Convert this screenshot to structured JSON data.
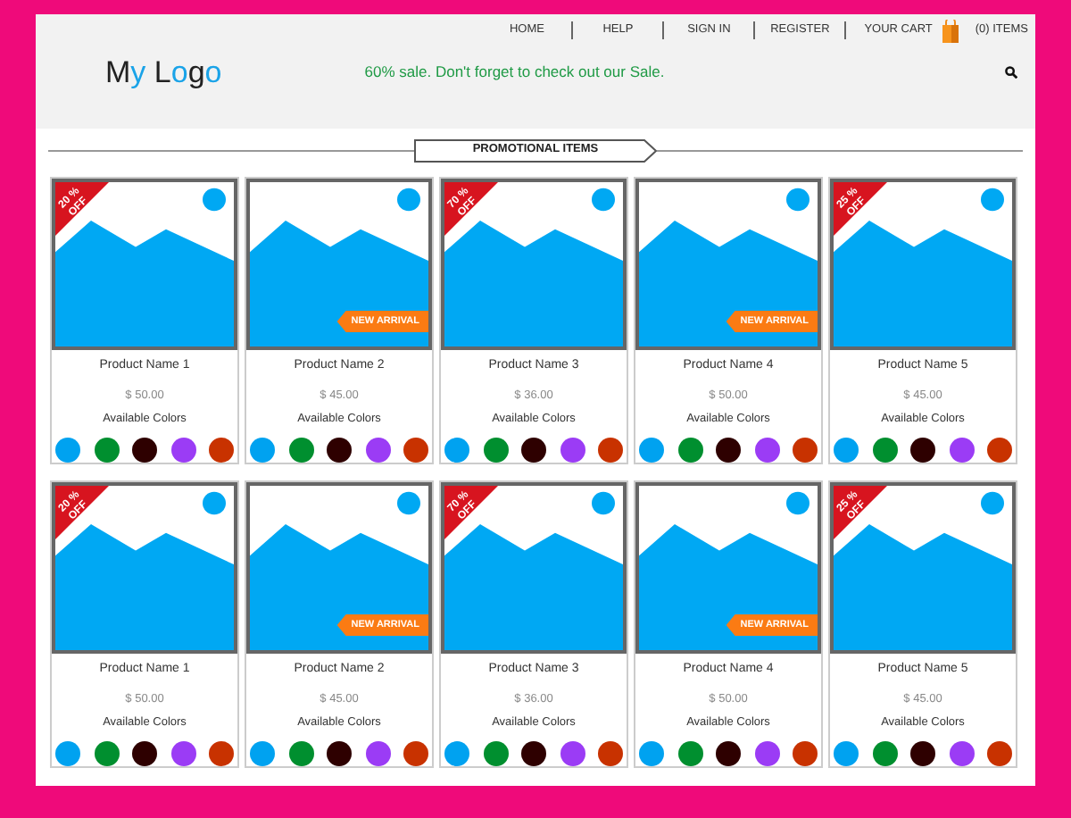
{
  "nav": {
    "links": [
      "HOME",
      "HELP",
      "SIGN IN",
      "REGISTER"
    ],
    "cart_label": "YOUR CART",
    "cart_count": "(0) ITEMS"
  },
  "header": {
    "logo": {
      "part1": "M",
      "part2": "y",
      "part3": " L",
      "part4": "o",
      "part5": "g",
      "part6": "o"
    },
    "announcement": "60% sale. Don't forget to check out our Sale."
  },
  "section_title": "PROMOTIONAL ITEMS",
  "rows": [
    {
      "products": [
        {
          "name": "Product Name 1",
          "price": "$ 50.00",
          "colors_label": "Available Colors",
          "discount": "20 % OFF",
          "colors": [
            {
              "color": "#00a2f0"
            },
            {
              "color": "#008f2f"
            },
            {
              "color": "#2e0000"
            },
            {
              "color": "#9b3cf5"
            },
            {
              "color": "#c83200"
            }
          ]
        },
        {
          "name": "Product Name 2",
          "price": "$ 45.00",
          "colors_label": "Available Colors",
          "new_arrival": "NEW ARRIVAL",
          "colors": [
            {
              "color": "#00a2f0"
            },
            {
              "color": "#008f2f"
            },
            {
              "color": "#2e0000"
            },
            {
              "color": "#9b3cf5"
            },
            {
              "color": "#c83200"
            }
          ]
        },
        {
          "name": "Product Name 3",
          "price": "$ 36.00",
          "colors_label": "Available Colors",
          "discount": "70 % OFF",
          "colors": [
            {
              "color": "#00a2f0"
            },
            {
              "color": "#008f2f"
            },
            {
              "color": "#2e0000"
            },
            {
              "color": "#9b3cf5"
            },
            {
              "color": "#c83200"
            }
          ]
        },
        {
          "name": "Product Name 4",
          "price": "$ 50.00",
          "colors_label": "Available Colors",
          "new_arrival": "NEW ARRIVAL",
          "colors": [
            {
              "color": "#00a2f0"
            },
            {
              "color": "#008f2f"
            },
            {
              "color": "#2e0000"
            },
            {
              "color": "#9b3cf5"
            },
            {
              "color": "#c83200"
            }
          ]
        },
        {
          "name": "Product Name 5",
          "price": "$ 45.00",
          "colors_label": "Available Colors",
          "discount": "25 % OFF",
          "colors": [
            {
              "color": "#00a2f0"
            },
            {
              "color": "#008f2f"
            },
            {
              "color": "#2e0000"
            },
            {
              "color": "#9b3cf5"
            },
            {
              "color": "#c83200"
            }
          ]
        }
      ]
    },
    {
      "products": [
        {
          "name": "Product Name 1",
          "price": "$ 50.00",
          "colors_label": "Available Colors",
          "discount": "20 % OFF",
          "colors": [
            {
              "color": "#00a2f0"
            },
            {
              "color": "#008f2f"
            },
            {
              "color": "#2e0000"
            },
            {
              "color": "#9b3cf5"
            },
            {
              "color": "#c83200"
            }
          ]
        },
        {
          "name": "Product Name 2",
          "price": "$ 45.00",
          "colors_label": "Available Colors",
          "new_arrival": "NEW ARRIVAL",
          "colors": [
            {
              "color": "#00a2f0"
            },
            {
              "color": "#008f2f"
            },
            {
              "color": "#2e0000"
            },
            {
              "color": "#9b3cf5"
            },
            {
              "color": "#c83200"
            }
          ]
        },
        {
          "name": "Product Name 3",
          "price": "$ 36.00",
          "colors_label": "Available Colors",
          "discount": "70 % OFF",
          "colors": [
            {
              "color": "#00a2f0"
            },
            {
              "color": "#008f2f"
            },
            {
              "color": "#2e0000"
            },
            {
              "color": "#9b3cf5"
            },
            {
              "color": "#c83200"
            }
          ]
        },
        {
          "name": "Product Name 4",
          "price": "$ 50.00",
          "colors_label": "Available Colors",
          "new_arrival": "NEW ARRIVAL",
          "colors": [
            {
              "color": "#00a2f0"
            },
            {
              "color": "#008f2f"
            },
            {
              "color": "#2e0000"
            },
            {
              "color": "#9b3cf5"
            },
            {
              "color": "#c83200"
            }
          ]
        },
        {
          "name": "Product Name 5",
          "price": "$ 45.00",
          "colors_label": "Available Colors",
          "discount": "25 % OFF",
          "colors": [
            {
              "color": "#00a2f0"
            },
            {
              "color": "#008f2f"
            },
            {
              "color": "#2e0000"
            },
            {
              "color": "#9b3cf5"
            },
            {
              "color": "#c83200"
            }
          ]
        }
      ]
    }
  ]
}
